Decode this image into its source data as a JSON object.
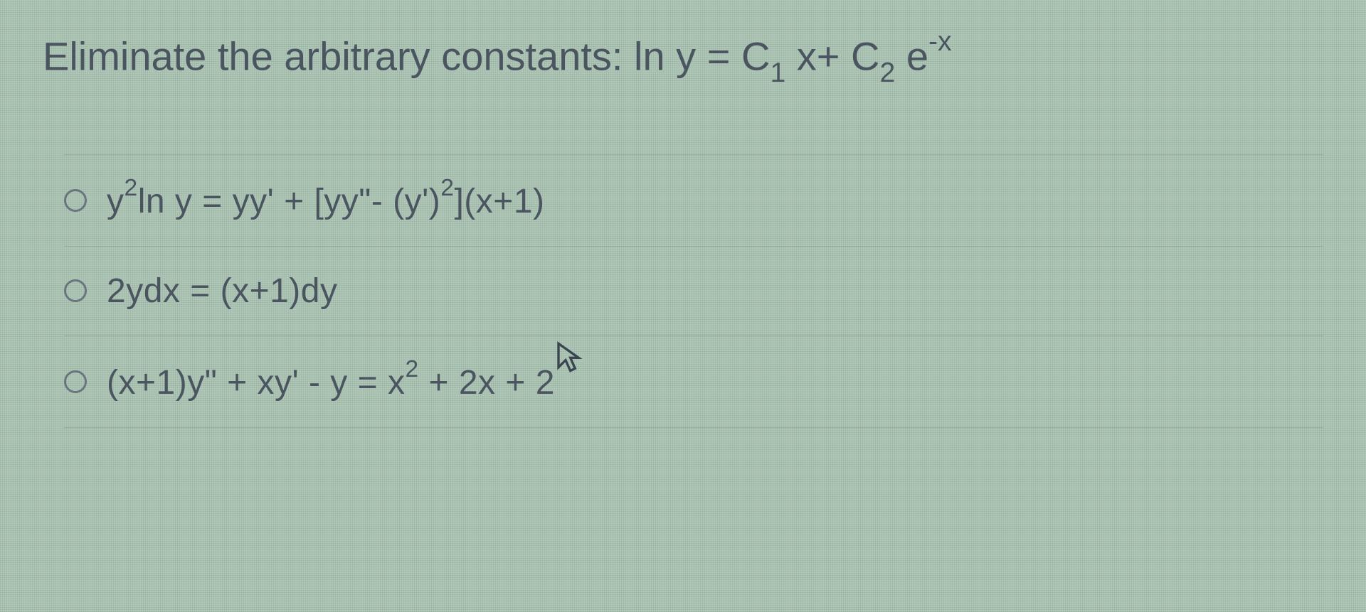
{
  "question": {
    "prefix": "Eliminate the arbitrary constants:  ln y = C",
    "sub1": "1",
    "mid": " x+ C",
    "sub2": "2",
    "exp_base": " e",
    "exp_sup": "-x"
  },
  "options": [
    {
      "parts": {
        "p1": "y",
        "sup1": "2",
        "p2": "ln y = yy' + [yy\"- (y')",
        "sup2": "2",
        "p3": "](x+1)"
      }
    },
    {
      "parts": {
        "p1": "2ydx = (x+1)dy"
      }
    },
    {
      "parts": {
        "p1": "(x+1)y\" + xy' - y = x",
        "sup1": "2",
        "p2": " + 2x + 2"
      }
    }
  ]
}
